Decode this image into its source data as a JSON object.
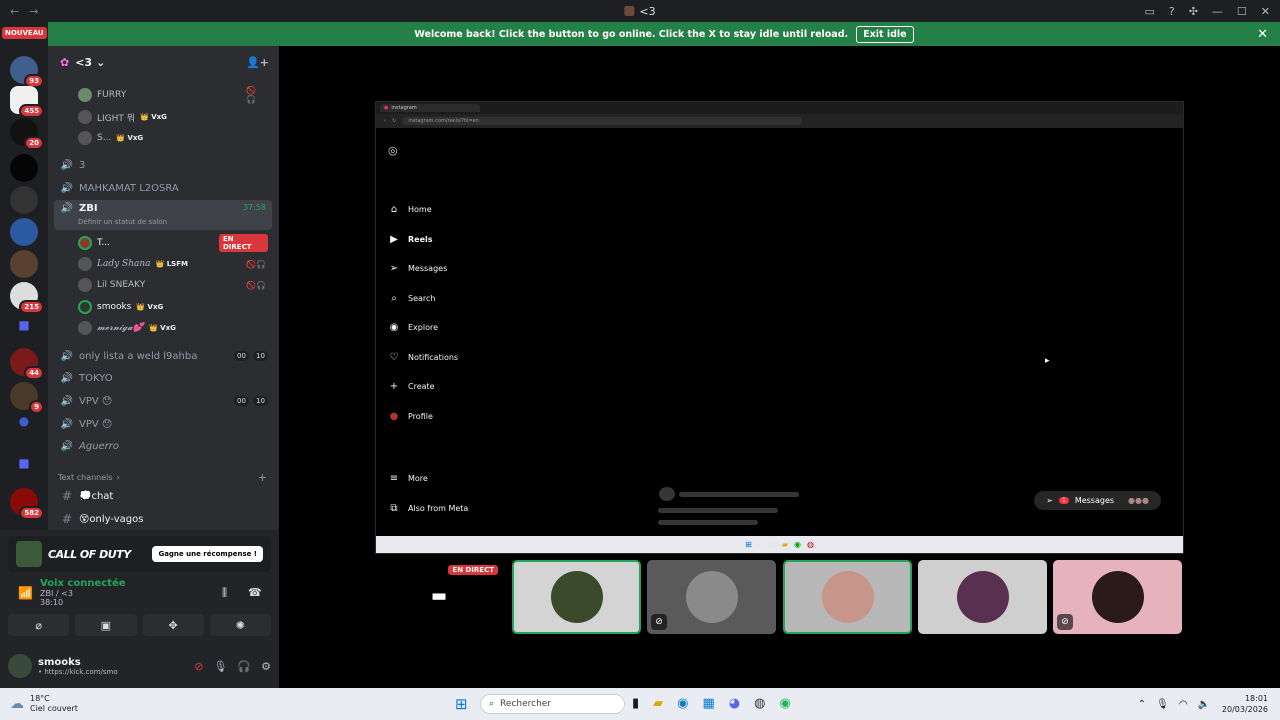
{
  "window": {
    "title": "<3",
    "back": "←",
    "fwd": "→",
    "icons": [
      "cast-icon",
      "help-icon",
      "tools-icon",
      "minimize-icon",
      "maximize-icon",
      "close-icon"
    ]
  },
  "guild_badges": {
    "nouveau": "NOUVEAU",
    "b1": "93",
    "b2": "455",
    "b3": "20",
    "b4": "215",
    "b5": "44",
    "b6": "9",
    "b7": "582"
  },
  "banner": {
    "text": "Welcome back! Click the button to go online. Click the X to stay idle until reload.",
    "button": "Exit idle",
    "close": "✕"
  },
  "server": {
    "name": "<3"
  },
  "channels": {
    "c3": "3",
    "mahkamat": "MAHKAMAT L2OSRA",
    "zbi": "ZBI",
    "zbi_time": "37:58",
    "zbi_status": "Définir un statut de salon",
    "only_lista": "only lista a weld l9ahba",
    "only_lista_a": "00",
    "only_lista_b": "10",
    "tokyo": "TOKYO",
    "vpv1": "VPV 😯",
    "vpv1_a": "00",
    "vpv1_b": "10",
    "vpv2": "VPV 😯",
    "aguerro": "Aguerro",
    "text_header": "Text channels",
    "chat": "💭chat",
    "vagos": "😵only-vagos"
  },
  "users": {
    "furry": "FURRY",
    "light": "LIGHT 뭐",
    "light_tag": "👑 VxG",
    "s": "S...",
    "s_tag": "👑 VxG",
    "t": "T...",
    "live": "EN DIRECT",
    "lady": "Lady Shana",
    "lady_tag": "👑 LSFM",
    "lil": "Lil SNEAKY",
    "smooks": "smooks",
    "smooks_tag": "👑 VxG",
    "merniga": "𝓶𝓮𝓻𝓷𝓲𝓰𝓪💕",
    "merniga_tag": "👑 VxG"
  },
  "promo": {
    "title": "CALL OF DUTY",
    "cta": "Gagne une récompense !"
  },
  "voice": {
    "status": "Voix connectée",
    "channel": "ZBI / <3",
    "time": "38:10"
  },
  "me": {
    "name": "smooks",
    "status": "• https://kick.com/smo"
  },
  "browser": {
    "tab": "instagram",
    "url": "instagram.com/reels/?hl=en"
  },
  "instagram": {
    "nav": [
      "Home",
      "Reels",
      "Messages",
      "Search",
      "Explore",
      "Notifications",
      "Create",
      "Profile"
    ],
    "more": "More",
    "meta": "Also from Meta",
    "messages_pill": "Messages",
    "msg_badge": "1"
  },
  "tiles": {
    "live": "EN DIRECT"
  },
  "taskbar": {
    "temp": "18°C",
    "weather": "Ciel couvert",
    "search": "Rechercher",
    "time": "18:01",
    "date": "20/03/2026"
  }
}
